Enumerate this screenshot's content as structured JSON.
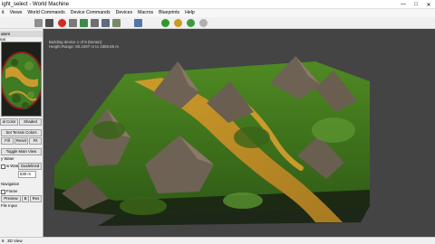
{
  "window": {
    "title": "ight_select - World Machine"
  },
  "menubar": {
    "items": [
      "it",
      "Views",
      "World Commands",
      "Device Commands",
      "Devices",
      "Macros",
      "Blueprints",
      "Help"
    ]
  },
  "toolbar": {
    "buttons": [
      {
        "icon": "camera-icon",
        "color": "#8f8f8f"
      },
      {
        "icon": "snapshot-icon",
        "color": "#4f4f4f"
      },
      {
        "icon": "stop-icon",
        "color": "#d42a20"
      },
      {
        "icon": "grid-icon",
        "color": "#7a7a7a"
      },
      {
        "icon": "diagonal-icon",
        "color": "#3c8a4c"
      },
      {
        "icon": "layers-icon",
        "color": "#6f6f6f"
      },
      {
        "icon": "filter-icon",
        "color": "#5c6b7e"
      },
      {
        "icon": "gallery-icon",
        "color": "#7a8a66"
      },
      {
        "icon": "home-icon",
        "color": "#5576a4"
      },
      {
        "icon": "build-icon",
        "color": "#2c9a2c"
      },
      {
        "icon": "build-all-icon",
        "color": "#c79c22"
      },
      {
        "icon": "render-icon",
        "color": "#3e9a3e"
      },
      {
        "icon": "settings-icon",
        "color": "#b0b0b0"
      }
    ]
  },
  "left_panel": {
    "title": "aters",
    "subtitle": "nat",
    "color_button": "al Color",
    "shaded_button": "Shaded",
    "set_terrain_colors": "Set Terrain Colors",
    "fill_button": "Fill",
    "reset_button": "Reset",
    "fit_button": "Fit",
    "toggle_main_view": "Toggle Main View",
    "water_label": "y Water",
    "water_check": "w Water",
    "guideline_button": "Guidelined",
    "height_value": "630 m",
    "navigation_label": "Navigation",
    "frame_label": "Frame",
    "preview_button": "Preview",
    "b_button": "B",
    "res_button": "Res",
    "file_input_label": "File Input"
  },
  "viewport": {
    "status_line_1": "Building device 1 of 8 (terrain)",
    "status_line_2": "Height Range: 80.2287 m to 1806.55 m",
    "colors": {
      "background": "#444444",
      "base": "#1c2a13",
      "low": "#cc9a2a",
      "mid": "#4f8a22",
      "high": "#3a6418",
      "rock": "#7a6c5a"
    }
  },
  "statusbar": {
    "left": "8",
    "view": "3D View"
  }
}
